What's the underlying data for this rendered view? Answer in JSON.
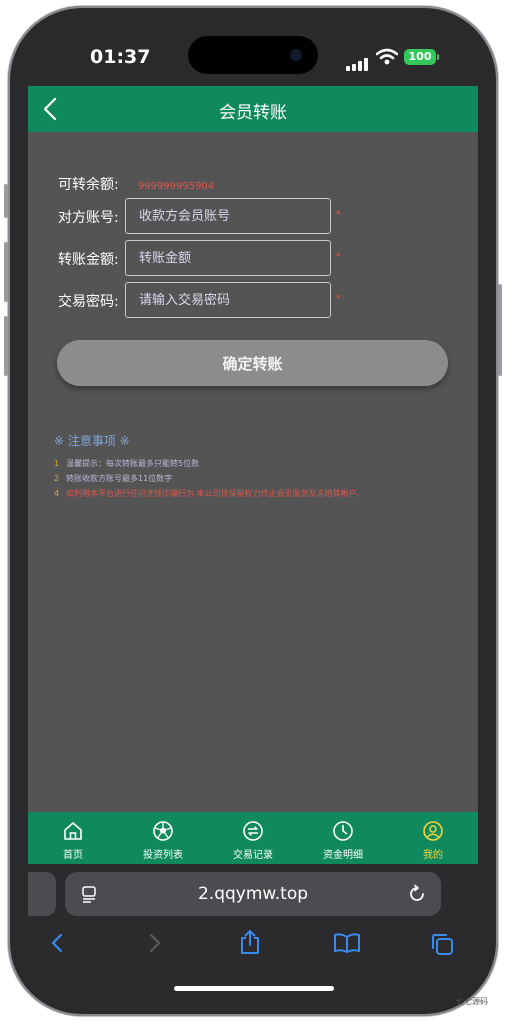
{
  "status_bar": {
    "time": "01:37",
    "battery": "100"
  },
  "header": {
    "title": "会员转账"
  },
  "form": {
    "balance_label": "可转余额:",
    "balance_value": "999999995904",
    "account_label": "对方账号:",
    "account_placeholder": "收款方会员账号",
    "amount_label": "转账金额:",
    "amount_placeholder": "转账金额",
    "password_label": "交易密码:",
    "password_placeholder": "请输入交易密码",
    "required_mark": "*",
    "submit_label": "确定转账"
  },
  "notes": {
    "title": "※ 注意事项 ※",
    "items": [
      {
        "num": "1",
        "text": "温馨提示：每次转账最多只能转5位数"
      },
      {
        "num": "2",
        "text": "转账收款方账号最多11位数字"
      },
      {
        "num": "4",
        "text": "如利用本平台进行任何洗钱诈骗行为,本公司将保留权力终止会员服务及冻结其帐户。"
      }
    ]
  },
  "tabs": [
    {
      "label": "首页",
      "icon": "home-icon"
    },
    {
      "label": "投资列表",
      "icon": "football-icon"
    },
    {
      "label": "交易记录",
      "icon": "exchange-icon"
    },
    {
      "label": "资金明细",
      "icon": "clock-icon"
    },
    {
      "label": "我的",
      "icon": "user-icon"
    }
  ],
  "browser": {
    "url": "2.qqymw.top"
  },
  "watermark": {
    "text": "七七源码"
  },
  "colors": {
    "accent": "#108a5d",
    "warning": "#e0564c",
    "active_tab": "#f5d33c"
  }
}
